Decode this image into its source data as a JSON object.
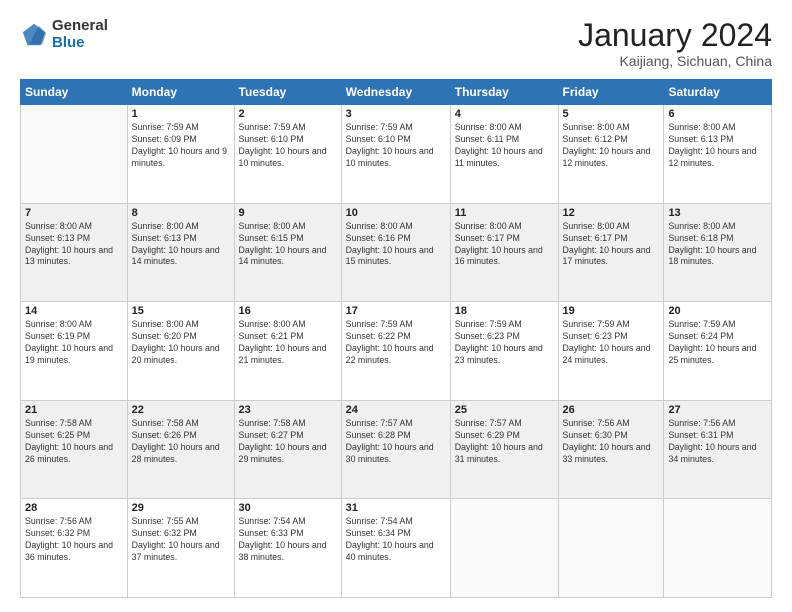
{
  "logo": {
    "general": "General",
    "blue": "Blue"
  },
  "header": {
    "month_title": "January 2024",
    "subtitle": "Kaijiang, Sichuan, China"
  },
  "weekdays": [
    "Sunday",
    "Monday",
    "Tuesday",
    "Wednesday",
    "Thursday",
    "Friday",
    "Saturday"
  ],
  "weeks": [
    [
      {
        "day": "",
        "sunrise": "",
        "sunset": "",
        "daylight": ""
      },
      {
        "day": "1",
        "sunrise": "Sunrise: 7:59 AM",
        "sunset": "Sunset: 6:09 PM",
        "daylight": "Daylight: 10 hours and 9 minutes."
      },
      {
        "day": "2",
        "sunrise": "Sunrise: 7:59 AM",
        "sunset": "Sunset: 6:10 PM",
        "daylight": "Daylight: 10 hours and 10 minutes."
      },
      {
        "day": "3",
        "sunrise": "Sunrise: 7:59 AM",
        "sunset": "Sunset: 6:10 PM",
        "daylight": "Daylight: 10 hours and 10 minutes."
      },
      {
        "day": "4",
        "sunrise": "Sunrise: 8:00 AM",
        "sunset": "Sunset: 6:11 PM",
        "daylight": "Daylight: 10 hours and 11 minutes."
      },
      {
        "day": "5",
        "sunrise": "Sunrise: 8:00 AM",
        "sunset": "Sunset: 6:12 PM",
        "daylight": "Daylight: 10 hours and 12 minutes."
      },
      {
        "day": "6",
        "sunrise": "Sunrise: 8:00 AM",
        "sunset": "Sunset: 6:13 PM",
        "daylight": "Daylight: 10 hours and 12 minutes."
      }
    ],
    [
      {
        "day": "7",
        "sunrise": "Sunrise: 8:00 AM",
        "sunset": "Sunset: 6:13 PM",
        "daylight": "Daylight: 10 hours and 13 minutes."
      },
      {
        "day": "8",
        "sunrise": "Sunrise: 8:00 AM",
        "sunset": "Sunset: 6:13 PM",
        "daylight": "Daylight: 10 hours and 14 minutes."
      },
      {
        "day": "9",
        "sunrise": "Sunrise: 8:00 AM",
        "sunset": "Sunset: 6:15 PM",
        "daylight": "Daylight: 10 hours and 14 minutes."
      },
      {
        "day": "10",
        "sunrise": "Sunrise: 8:00 AM",
        "sunset": "Sunset: 6:16 PM",
        "daylight": "Daylight: 10 hours and 15 minutes."
      },
      {
        "day": "11",
        "sunrise": "Sunrise: 8:00 AM",
        "sunset": "Sunset: 6:17 PM",
        "daylight": "Daylight: 10 hours and 16 minutes."
      },
      {
        "day": "12",
        "sunrise": "Sunrise: 8:00 AM",
        "sunset": "Sunset: 6:17 PM",
        "daylight": "Daylight: 10 hours and 17 minutes."
      },
      {
        "day": "13",
        "sunrise": "Sunrise: 8:00 AM",
        "sunset": "Sunset: 6:18 PM",
        "daylight": "Daylight: 10 hours and 18 minutes."
      }
    ],
    [
      {
        "day": "14",
        "sunrise": "Sunrise: 8:00 AM",
        "sunset": "Sunset: 6:19 PM",
        "daylight": "Daylight: 10 hours and 19 minutes."
      },
      {
        "day": "15",
        "sunrise": "Sunrise: 8:00 AM",
        "sunset": "Sunset: 6:20 PM",
        "daylight": "Daylight: 10 hours and 20 minutes."
      },
      {
        "day": "16",
        "sunrise": "Sunrise: 8:00 AM",
        "sunset": "Sunset: 6:21 PM",
        "daylight": "Daylight: 10 hours and 21 minutes."
      },
      {
        "day": "17",
        "sunrise": "Sunrise: 7:59 AM",
        "sunset": "Sunset: 6:22 PM",
        "daylight": "Daylight: 10 hours and 22 minutes."
      },
      {
        "day": "18",
        "sunrise": "Sunrise: 7:59 AM",
        "sunset": "Sunset: 6:23 PM",
        "daylight": "Daylight: 10 hours and 23 minutes."
      },
      {
        "day": "19",
        "sunrise": "Sunrise: 7:59 AM",
        "sunset": "Sunset: 6:23 PM",
        "daylight": "Daylight: 10 hours and 24 minutes."
      },
      {
        "day": "20",
        "sunrise": "Sunrise: 7:59 AM",
        "sunset": "Sunset: 6:24 PM",
        "daylight": "Daylight: 10 hours and 25 minutes."
      }
    ],
    [
      {
        "day": "21",
        "sunrise": "Sunrise: 7:58 AM",
        "sunset": "Sunset: 6:25 PM",
        "daylight": "Daylight: 10 hours and 26 minutes."
      },
      {
        "day": "22",
        "sunrise": "Sunrise: 7:58 AM",
        "sunset": "Sunset: 6:26 PM",
        "daylight": "Daylight: 10 hours and 28 minutes."
      },
      {
        "day": "23",
        "sunrise": "Sunrise: 7:58 AM",
        "sunset": "Sunset: 6:27 PM",
        "daylight": "Daylight: 10 hours and 29 minutes."
      },
      {
        "day": "24",
        "sunrise": "Sunrise: 7:57 AM",
        "sunset": "Sunset: 6:28 PM",
        "daylight": "Daylight: 10 hours and 30 minutes."
      },
      {
        "day": "25",
        "sunrise": "Sunrise: 7:57 AM",
        "sunset": "Sunset: 6:29 PM",
        "daylight": "Daylight: 10 hours and 31 minutes."
      },
      {
        "day": "26",
        "sunrise": "Sunrise: 7:56 AM",
        "sunset": "Sunset: 6:30 PM",
        "daylight": "Daylight: 10 hours and 33 minutes."
      },
      {
        "day": "27",
        "sunrise": "Sunrise: 7:56 AM",
        "sunset": "Sunset: 6:31 PM",
        "daylight": "Daylight: 10 hours and 34 minutes."
      }
    ],
    [
      {
        "day": "28",
        "sunrise": "Sunrise: 7:56 AM",
        "sunset": "Sunset: 6:32 PM",
        "daylight": "Daylight: 10 hours and 36 minutes."
      },
      {
        "day": "29",
        "sunrise": "Sunrise: 7:55 AM",
        "sunset": "Sunset: 6:32 PM",
        "daylight": "Daylight: 10 hours and 37 minutes."
      },
      {
        "day": "30",
        "sunrise": "Sunrise: 7:54 AM",
        "sunset": "Sunset: 6:33 PM",
        "daylight": "Daylight: 10 hours and 38 minutes."
      },
      {
        "day": "31",
        "sunrise": "Sunrise: 7:54 AM",
        "sunset": "Sunset: 6:34 PM",
        "daylight": "Daylight: 10 hours and 40 minutes."
      },
      {
        "day": "",
        "sunrise": "",
        "sunset": "",
        "daylight": ""
      },
      {
        "day": "",
        "sunrise": "",
        "sunset": "",
        "daylight": ""
      },
      {
        "day": "",
        "sunrise": "",
        "sunset": "",
        "daylight": ""
      }
    ]
  ]
}
